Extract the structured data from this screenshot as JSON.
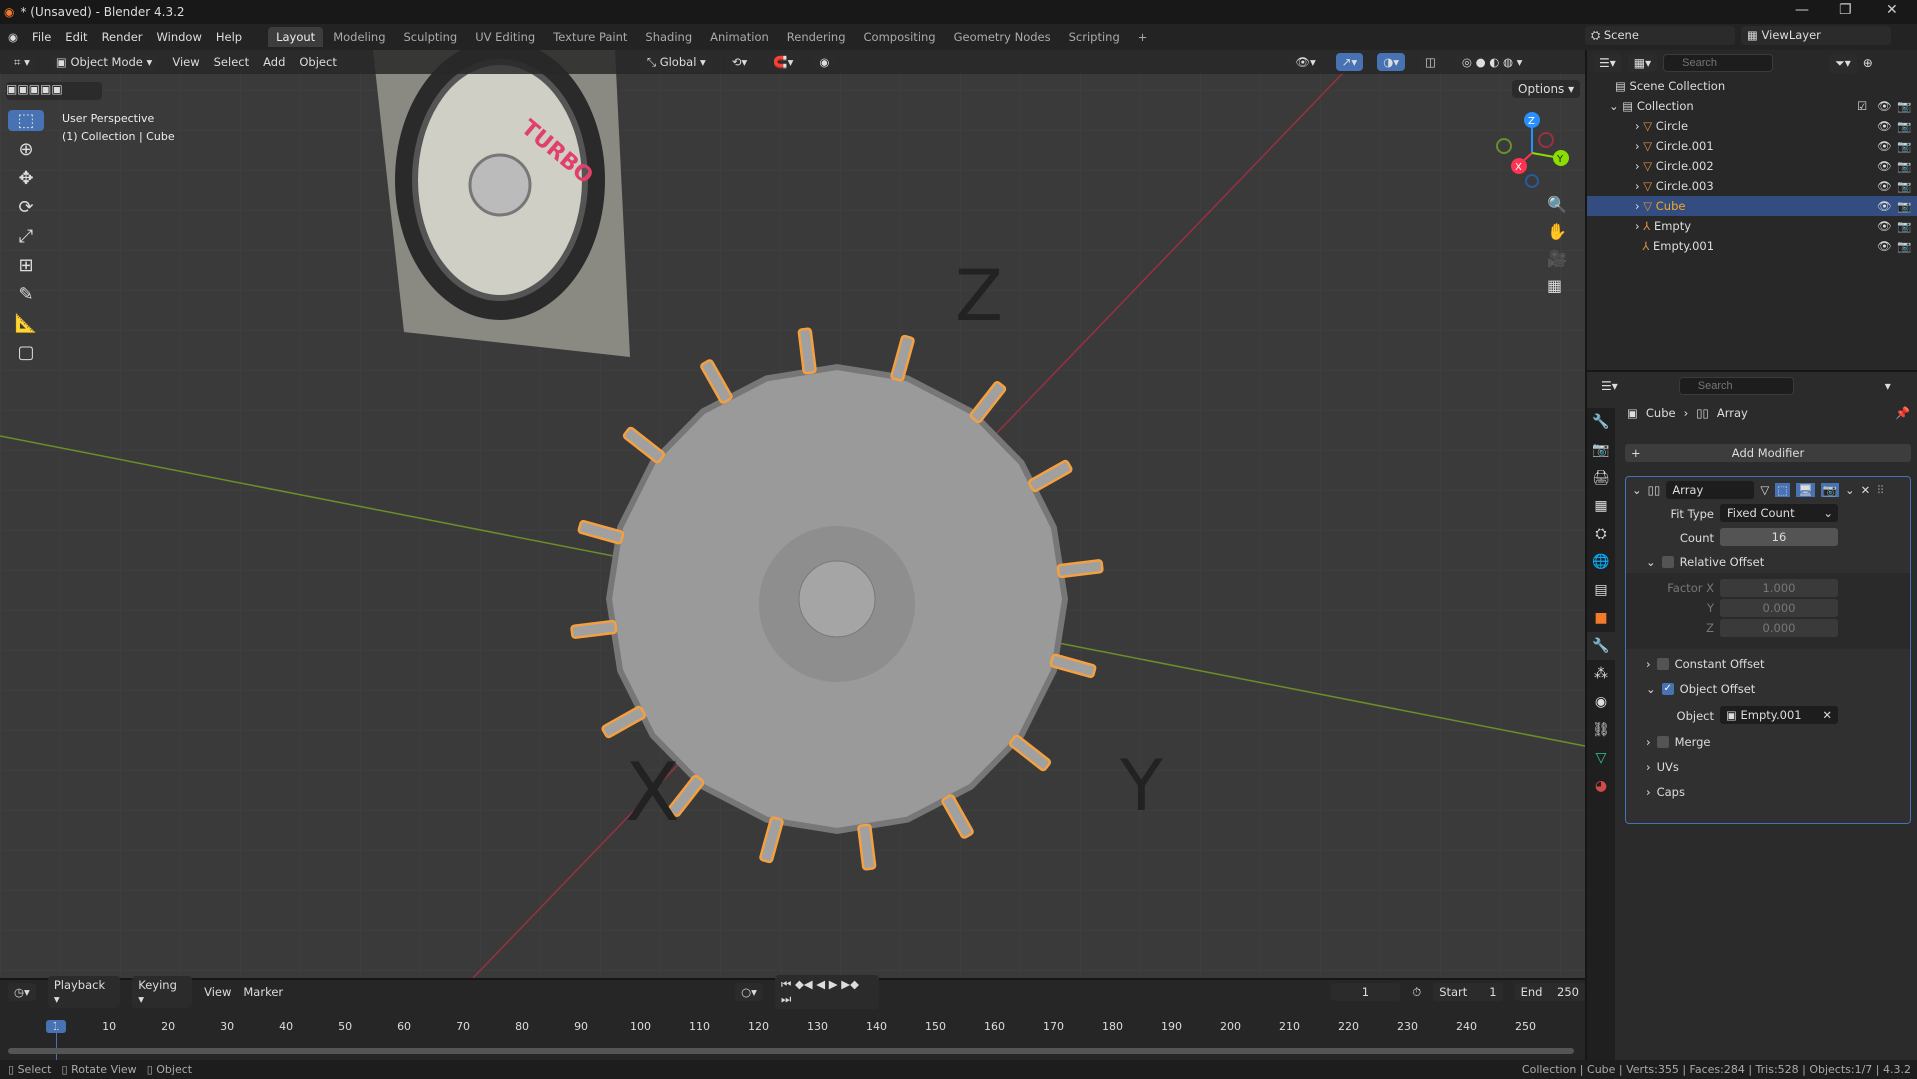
{
  "window": {
    "title": "* (Unsaved) - Blender 4.3.2",
    "minimize": "—",
    "maximize": "❐",
    "close": "✕"
  },
  "menu": [
    "File",
    "Edit",
    "Render",
    "Window",
    "Help"
  ],
  "workspaces": [
    "Layout",
    "Modeling",
    "Sculpting",
    "UV Editing",
    "Texture Paint",
    "Shading",
    "Animation",
    "Rendering",
    "Compositing",
    "Geometry Nodes",
    "Scripting",
    "+"
  ],
  "scene": {
    "name": "Scene",
    "view_layer": "ViewLayer"
  },
  "viewport": {
    "mode": "Object Mode",
    "menus": [
      "View",
      "Select",
      "Add",
      "Object"
    ],
    "orientation": "Global",
    "options": "Options",
    "overlay_line1": "User Perspective",
    "overlay_line2": "(1) Collection | Cube",
    "gizmo": {
      "x": "X",
      "y": "Y",
      "z": "Z"
    },
    "axis_colors": {
      "x": "#ff3352",
      "y": "#8bdc00",
      "z": "#2890ff"
    }
  },
  "outliner": {
    "search_placeholder": "Search",
    "scene_collection": "Scene Collection",
    "collection": "Collection",
    "items": [
      {
        "name": "Circle",
        "selected": false
      },
      {
        "name": "Circle.001",
        "selected": false
      },
      {
        "name": "Circle.002",
        "selected": false
      },
      {
        "name": "Circle.003",
        "selected": false
      },
      {
        "name": "Cube",
        "selected": true
      },
      {
        "name": "Empty",
        "selected": false
      },
      {
        "name": "Empty.001",
        "selected": false
      }
    ]
  },
  "properties": {
    "search_placeholder": "Search",
    "breadcrumb_object": "Cube",
    "breadcrumb_modifier": "Array",
    "add_modifier": "Add Modifier",
    "modifier_name": "Array",
    "fit_type_label": "Fit Type",
    "fit_type": "Fixed Count",
    "count_label": "Count",
    "count": "16",
    "relative_offset": "Relative Offset",
    "relative_offset_enabled": false,
    "factor_x_label": "Factor X",
    "factor_x": "1.000",
    "y_label": "Y",
    "factor_y": "0.000",
    "z_label": "Z",
    "factor_z": "0.000",
    "constant_offset": "Constant Offset",
    "object_offset": "Object Offset",
    "object_offset_enabled": true,
    "object_label": "Object",
    "object_value": "Empty.001",
    "merge": "Merge",
    "uvs": "UVs",
    "caps": "Caps"
  },
  "timeline": {
    "menus": [
      "Playback",
      "Keying",
      "View",
      "Marker"
    ],
    "current_frame": "1",
    "start_label": "Start",
    "start": "1",
    "end_label": "End",
    "end": "250",
    "ticks": [
      "1",
      "10",
      "20",
      "30",
      "40",
      "50",
      "60",
      "70",
      "80",
      "90",
      "100",
      "110",
      "120",
      "130",
      "140",
      "150",
      "160",
      "170",
      "180",
      "190",
      "200",
      "210",
      "220",
      "230",
      "240",
      "250"
    ]
  },
  "status": {
    "select": "Select",
    "rotate": "Rotate View",
    "object": "Object",
    "info": "Collection | Cube | Verts:355 | Faces:284 | Tris:528 | Objects:1/7 | 4.3.2"
  }
}
